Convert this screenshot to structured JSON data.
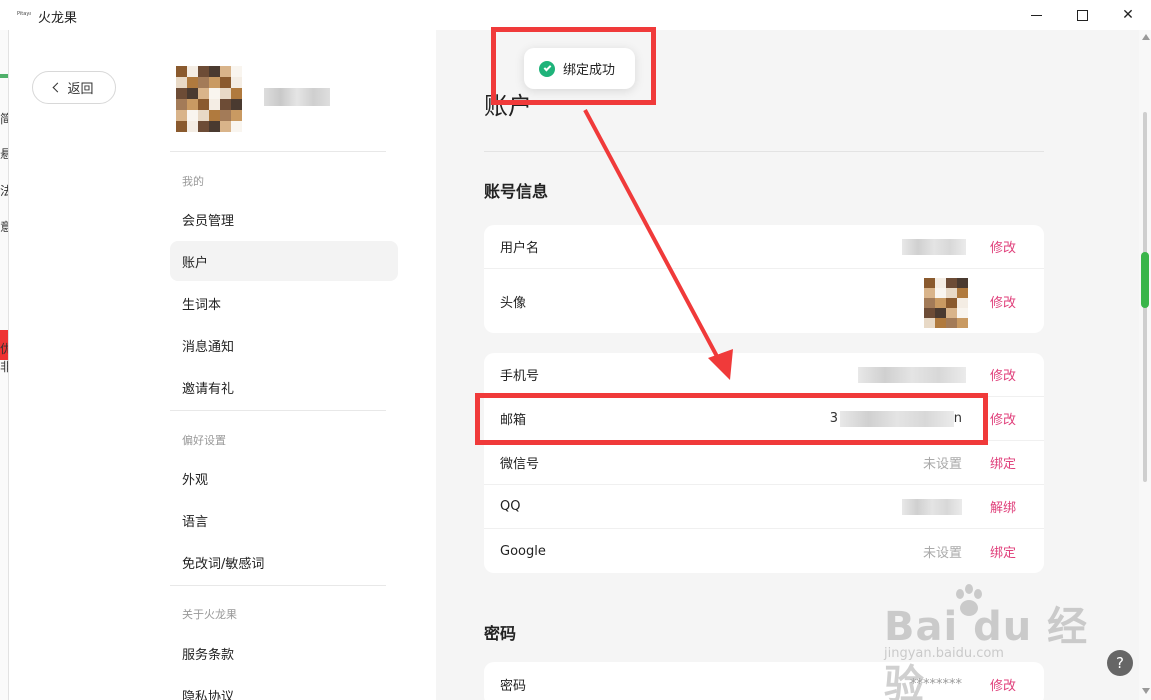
{
  "window": {
    "title": "火龙果",
    "logo_text": "Pitaya"
  },
  "back_button": {
    "label": "返回"
  },
  "sidebar": {
    "sections": [
      {
        "label": "我的",
        "items": [
          "会员管理",
          "账户",
          "生词本",
          "消息通知",
          "邀请有礼"
        ]
      },
      {
        "label": "偏好设置",
        "items": [
          "外观",
          "语言",
          "免改词/敏感词"
        ]
      },
      {
        "label": "关于火龙果",
        "items": [
          "服务条款",
          "隐私协议"
        ]
      }
    ],
    "active_item": "账户"
  },
  "main": {
    "page_title": "账户",
    "account_section_title": "账号信息",
    "card1": [
      {
        "label": "用户名",
        "action": "修改"
      },
      {
        "label": "头像",
        "action": "修改"
      }
    ],
    "card2": [
      {
        "label": "手机号",
        "action": "修改"
      },
      {
        "label": "邮箱",
        "value_prefix": "3",
        "value_suffix": "n",
        "action": "修改"
      },
      {
        "label": "微信号",
        "value": "未设置",
        "action": "绑定"
      },
      {
        "label": "QQ",
        "action": "解绑"
      },
      {
        "label": "Google",
        "value": "未设置",
        "action": "绑定"
      }
    ],
    "password_section_title": "密码",
    "card3": [
      {
        "label": "密码",
        "value": "********",
        "action": "修改"
      }
    ]
  },
  "toast": {
    "message": "绑定成功"
  },
  "watermark": {
    "main": "Bai du 经验",
    "sub": "jingyan.baidu.com"
  },
  "help": {
    "label": "?"
  },
  "colors": {
    "accent": "#e0407b",
    "success": "#1fb37a",
    "annotation": "#f03a3a",
    "scroll_thumb": "#3ab54a"
  }
}
